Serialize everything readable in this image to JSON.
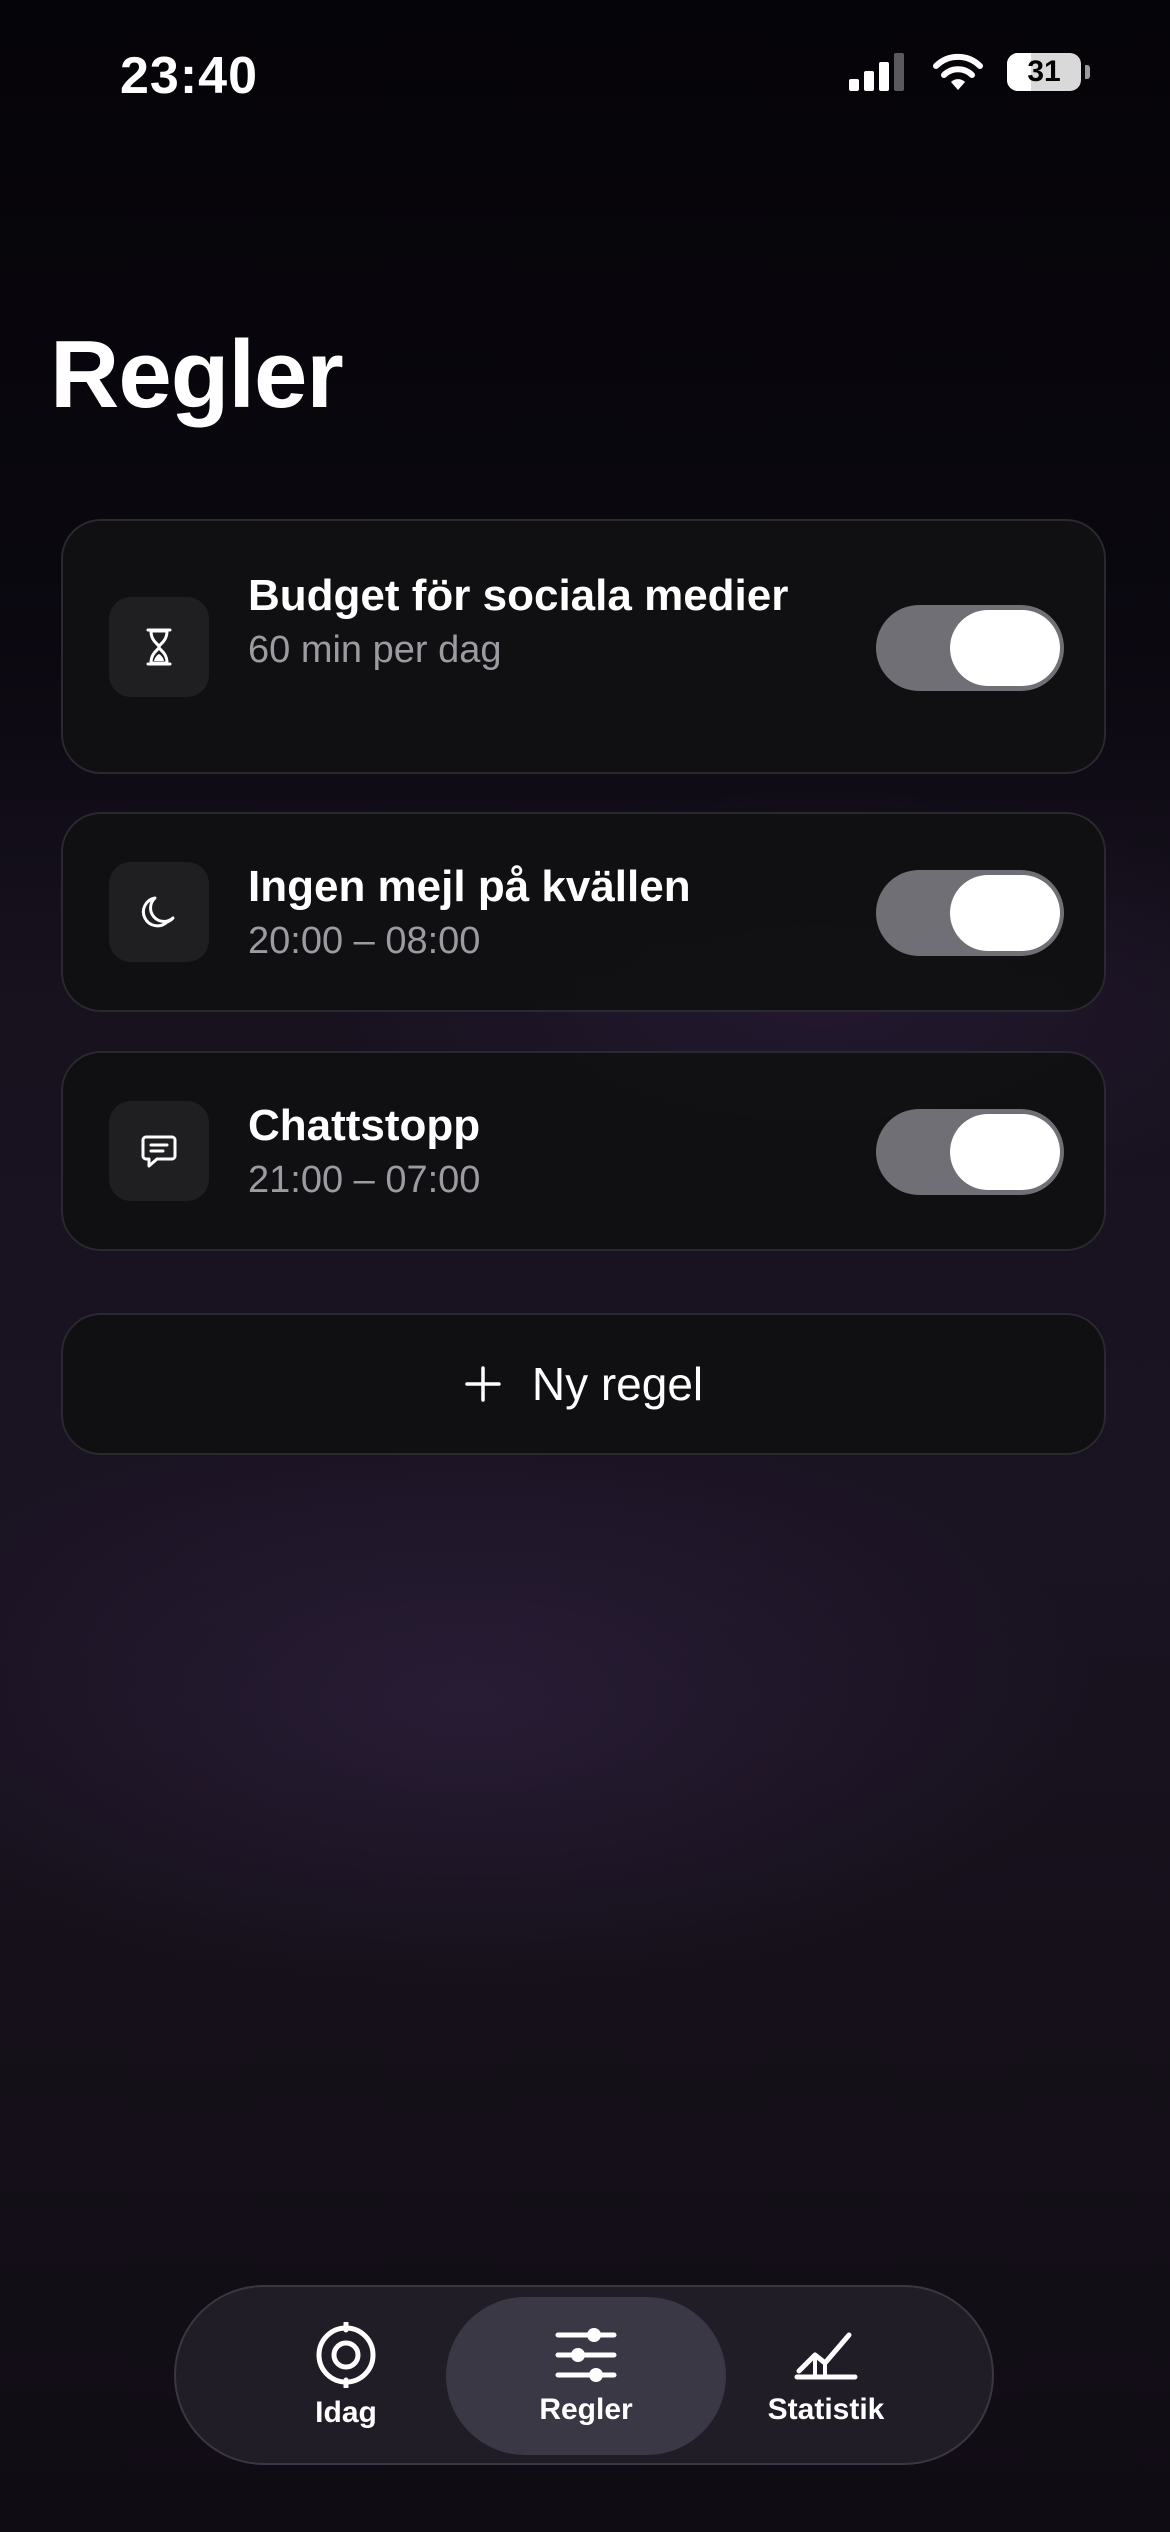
{
  "status_bar": {
    "time": "23:40",
    "battery_percent": "31",
    "icons": [
      "signal-icon",
      "wifi-icon",
      "battery-icon"
    ]
  },
  "page": {
    "title": "Regler"
  },
  "rules": [
    {
      "title": "Budget för sociala medier",
      "subtitle": "60 min per dag",
      "icon": "hourglass-icon",
      "enabled": true
    },
    {
      "title": "Ingen mejl på kvällen",
      "subtitle": "20:00 – 08:00",
      "icon": "moon-icon",
      "enabled": true
    },
    {
      "title": "Chattstopp",
      "subtitle": "21:00 – 07:00",
      "icon": "chat-bubble-icon",
      "enabled": true
    }
  ],
  "new_rule_button": {
    "label": "Ny regel",
    "icon": "plus-icon"
  },
  "tab_bar": {
    "tabs": [
      {
        "label": "Idag",
        "icon": "target-icon",
        "active": false
      },
      {
        "label": "Regler",
        "icon": "sliders-icon",
        "active": true
      },
      {
        "label": "Statistik",
        "icon": "chart-line-icon",
        "active": false
      }
    ]
  },
  "colors": {
    "toggle_on": "#6f6f75",
    "card_background": "#111113",
    "active_tab": "#3b3845"
  }
}
